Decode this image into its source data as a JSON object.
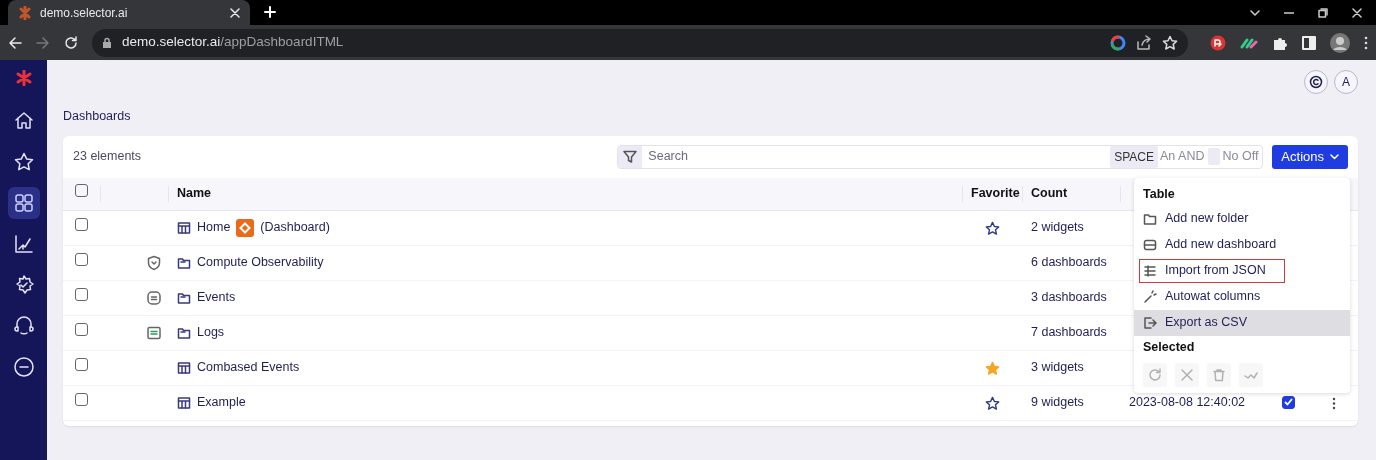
{
  "browser": {
    "tab_title": "demo.selector.ai",
    "url": {
      "host": "demo.selector.ai",
      "path": "/appDashboardITML"
    }
  },
  "sidebar": {
    "items": [
      {
        "kind": "home",
        "selected": false
      },
      {
        "kind": "favorites",
        "selected": false
      },
      {
        "kind": "dashboards",
        "selected": true
      },
      {
        "kind": "analytics",
        "selected": false
      },
      {
        "kind": "settings",
        "selected": false
      },
      {
        "kind": "integrations",
        "selected": false
      },
      {
        "kind": "logout",
        "selected": false
      }
    ]
  },
  "header": {
    "avatar": "A"
  },
  "breadcrumb": "Dashboards",
  "toolbar": {
    "count": "23 elements",
    "search": {
      "placeholder": "Search"
    },
    "hints": [
      {
        "key": "SPACE",
        "label": "An AND"
      },
      {
        "label": "No Off"
      }
    ],
    "actions_button": "Actions"
  },
  "table": {
    "header_checked": false,
    "columns": [
      "Name",
      "Favorite",
      "Count"
    ],
    "rows": [
      {
        "checked": false,
        "kind": "dashboard",
        "name": "Home",
        "badge": true,
        "suffix": "(Dashboard)",
        "favorite": false,
        "count": "2 widgets"
      },
      {
        "checked": false,
        "kind": "folder",
        "marker": {
          "kind": "observability"
        },
        "name": "Compute Observability",
        "count": "6 dashboards"
      },
      {
        "checked": false,
        "kind": "folder",
        "marker": {
          "kind": "events"
        },
        "name": "Events",
        "count": "3 dashboards"
      },
      {
        "checked": false,
        "kind": "folder",
        "marker": {
          "kind": "logs"
        },
        "name": "Logs",
        "count": "7 dashboards"
      },
      {
        "checked": false,
        "kind": "dashboard",
        "name": "Combased Events",
        "favorite": true,
        "count": "3 widgets"
      },
      {
        "checked": false,
        "kind": "dashboard",
        "name": "Example",
        "favorite": false,
        "count": "9 widgets",
        "column_4": "2023-08-08 12:40:02",
        "column_5_checked": true,
        "menu": true
      }
    ]
  },
  "actions_menu": {
    "sections": [
      {
        "title": "Table",
        "items": [
          {
            "kind": "folder",
            "label": "Add new folder",
            "selected": false,
            "outlined": false
          },
          {
            "kind": "dashboard",
            "label": "Add new dashboard",
            "selected": false,
            "outlined": false
          },
          {
            "kind": "import",
            "label": "Import from JSON",
            "selected": false,
            "outlined": true
          },
          {
            "kind": "columns",
            "label": "Autowat columns",
            "selected": false,
            "outlined": false
          },
          {
            "kind": "export",
            "label": "Export as CSV",
            "selected": true,
            "outlined": false
          }
        ]
      },
      {
        "title": "Selected",
        "buttons": [
          {
            "kind": "refresh",
            "disabled": true
          },
          {
            "kind": "clear",
            "disabled": true
          },
          {
            "kind": "delete",
            "disabled": true
          },
          {
            "kind": "trend",
            "disabled": true
          }
        ]
      }
    ]
  }
}
